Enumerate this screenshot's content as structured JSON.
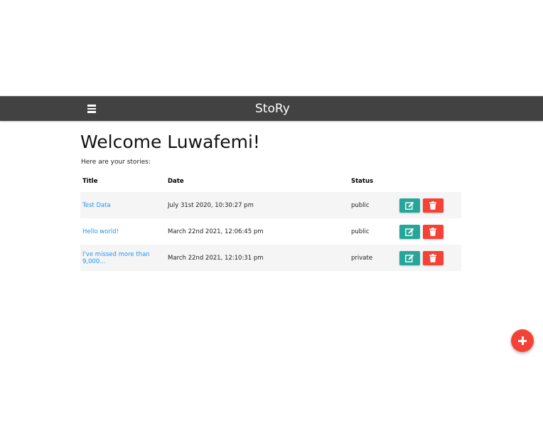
{
  "navbar": {
    "brand": "StoRy",
    "background": "#424242",
    "menu_icon": "hamburger-menu-icon"
  },
  "main": {
    "heading": "Welcome Luwafemi!",
    "subtitle": "Here are your stories:"
  },
  "table": {
    "headers": {
      "title": "Title",
      "date": "Date",
      "status": "Status"
    },
    "rows": [
      {
        "title": "Test Data",
        "date": "July 31st 2020, 10:30:27 pm",
        "status": "public"
      },
      {
        "title": "Hello world!",
        "date": "March 22nd 2021, 12:06:45 pm",
        "status": "public"
      },
      {
        "title": "I've missed more than 9,000...",
        "date": "March 22nd 2021, 12:10:31 pm",
        "status": "private"
      }
    ],
    "edit_icon": "edit-icon",
    "delete_icon": "trash-icon",
    "edit_color": "#26a69a",
    "delete_color": "#f44336",
    "link_color": "#2196f3"
  },
  "fab": {
    "icon": "plus-icon",
    "color": "#f44336"
  }
}
